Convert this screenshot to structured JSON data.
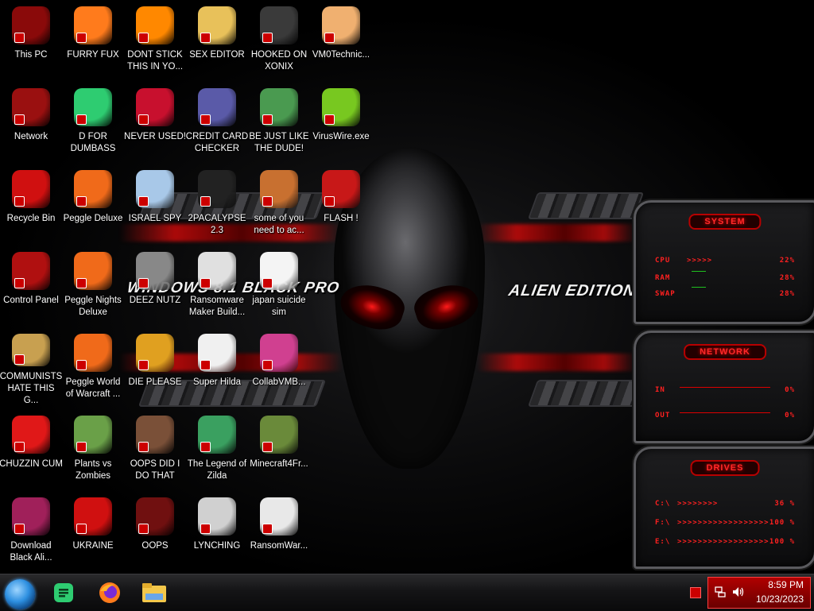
{
  "wallpaper": {
    "title": "WINDOWS 8.1 BLACK PRO",
    "edition": "ALIEN EDITION 20"
  },
  "desktop_icons": [
    {
      "label": "This PC",
      "icon": "monitor-icon"
    },
    {
      "label": "FURRY FUX",
      "icon": "firefox-icon"
    },
    {
      "label": "DONT STICK THIS IN YO...",
      "icon": "vlc-cone-icon"
    },
    {
      "label": "SEX EDITOR",
      "icon": "hxd-editor-icon"
    },
    {
      "label": "HOOKED ON XONIX",
      "icon": "xonix-game-icon"
    },
    {
      "label": "VM0Technic...",
      "icon": "doctor-person-icon"
    },
    {
      "label": "Network",
      "icon": "network-icon"
    },
    {
      "label": "D FOR DUMBASS",
      "icon": "discord-icon"
    },
    {
      "label": "NEVER USED!",
      "icon": "dev-cpp-icon"
    },
    {
      "label": "CREDIT CARD CHECKER",
      "icon": "credit-card-icon"
    },
    {
      "label": "BE JUST LIKE THE DUDE!",
      "icon": "elf-character-icon"
    },
    {
      "label": "VirusWire.exe",
      "icon": "lime-icon"
    },
    {
      "label": "Recycle Bin",
      "icon": "recycle-bin-icon"
    },
    {
      "label": "Peggle Deluxe",
      "icon": "peggle-icon"
    },
    {
      "label": "ISRAEL SPY",
      "icon": "spy-camera-icon"
    },
    {
      "label": "2PACALYPSE 2.3",
      "icon": "terminal-icon"
    },
    {
      "label": "some of you need to ac...",
      "icon": "beaver-icon"
    },
    {
      "label": "FLASH !",
      "icon": "flash-icon"
    },
    {
      "label": "Control Panel",
      "icon": "control-panel-icon"
    },
    {
      "label": "Peggle Nights Deluxe",
      "icon": "peggle-icon"
    },
    {
      "label": "DEEZ NUTZ",
      "icon": "stacked-windows-icon"
    },
    {
      "label": "Ransomware Maker Build...",
      "icon": "ransomware-builder-icon"
    },
    {
      "label": "japan suicide sim",
      "icon": "document-icon"
    },
    {
      "label": "COMMUNISTS HATE THIS G...",
      "icon": "money-bag-icon"
    },
    {
      "label": "Peggle World of Warcraft ...",
      "icon": "peggle-icon"
    },
    {
      "label": "DIE PLEASE",
      "icon": "de-app-icon"
    },
    {
      "label": "Super Hilda",
      "icon": "pixel-character-icon"
    },
    {
      "label": "CollabVMB...",
      "icon": "collabvm-icon"
    },
    {
      "label": "CHUZZIN CUM",
      "icon": "chuzzle-icon"
    },
    {
      "label": "Plants vs Zombies",
      "icon": "plant-icon"
    },
    {
      "label": "OOPS DID I DO THAT",
      "icon": "portrait-icon"
    },
    {
      "label": "The Legend of Zilda",
      "icon": "link-character-icon"
    },
    {
      "label": "Minecraft4Fr...",
      "icon": "grass-block-icon"
    },
    {
      "label": "Download Black Ali...",
      "icon": "alien-orb-icon"
    },
    {
      "label": "UKRAINE",
      "icon": "radiation-icon"
    },
    {
      "label": "OOPS",
      "icon": "skull-monitor-icon"
    },
    {
      "label": "LYNCHING",
      "icon": "hanging-icon"
    },
    {
      "label": "RansomWar...",
      "icon": "skull-icon"
    }
  ],
  "gadgets": {
    "system": {
      "title": "SYSTEM",
      "rows": [
        {
          "label": "CPU",
          "arrows": ">>>>>",
          "value": "22%"
        },
        {
          "label": "RAM",
          "arrows": "",
          "value": "28%"
        },
        {
          "label": "SWAP",
          "arrows": "",
          "value": "28%"
        }
      ]
    },
    "network": {
      "title": "NETWORK",
      "rows": [
        {
          "label": "IN",
          "value": "0%"
        },
        {
          "label": "OUT",
          "value": "0%"
        }
      ]
    },
    "drives": {
      "title": "DRIVES",
      "rows": [
        {
          "label": "C:\\",
          "arrows": ">>>>>>>>",
          "value": "36 %"
        },
        {
          "label": "F:\\",
          "arrows": ">>>>>>>>>>>>>>>>>>",
          "value": "100 %"
        },
        {
          "label": "E:\\",
          "arrows": ">>>>>>>>>>>>>>>>>>",
          "value": "100 %"
        }
      ]
    }
  },
  "taskbar": {
    "apps": [
      {
        "name": "discord",
        "icon": "discord-icon"
      },
      {
        "name": "firefox",
        "icon": "firefox-icon"
      },
      {
        "name": "file-explorer",
        "icon": "folder-icon"
      }
    ],
    "clock": {
      "time": "8:59 PM",
      "date": "10/23/2023"
    }
  }
}
